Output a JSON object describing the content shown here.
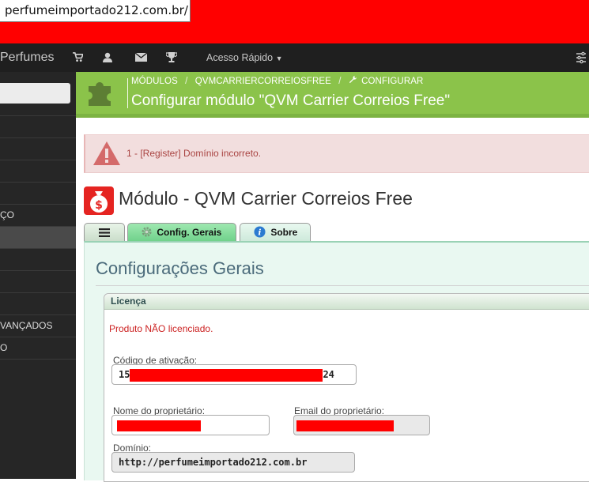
{
  "browser": {
    "url": "perfumeimportado212.com.br/"
  },
  "header": {
    "brand": "Perfumes",
    "icons": [
      "cart-icon",
      "user-icon",
      "envelope-icon",
      "trophy-icon"
    ],
    "quick_access": "Acesso Rápido",
    "right_icon": "settings-icon"
  },
  "sidebar": {
    "items": [
      {
        "label": ""
      },
      {
        "label": ""
      },
      {
        "label": ""
      },
      {
        "label": ""
      },
      {
        "label": "ÇO"
      },
      {
        "label": ""
      },
      {
        "label": ""
      },
      {
        "label": ""
      },
      {
        "label": ""
      },
      {
        "label": "VANÇADOS"
      },
      {
        "label": "O"
      }
    ],
    "active_index": 5
  },
  "module_header": {
    "breadcrumb": [
      "MÓDULOS",
      "QVMCARRIERCORREIOSFREE",
      "CONFIGURAR"
    ],
    "title": "Configurar módulo \"QVM Carrier Correios Free\""
  },
  "alert": {
    "text": "1 - [Register] Domínio incorreto."
  },
  "module": {
    "title": "Módulo - QVM Carrier Correios Free",
    "tabs": [
      "",
      "Config. Gerais",
      "Sobre"
    ]
  },
  "config": {
    "title": "Configurações Gerais",
    "legend": "Licença",
    "status": "Produto NÃO licenciado.",
    "activation_label": "Código de ativação:",
    "activation_prefix": "15",
    "activation_suffix": "24",
    "owner_label": "Nome do proprietário:",
    "email_label": "Email do proprietário:",
    "domain_label": "Domínio:",
    "domain_value": "http://perfumeimportado212.com.br"
  },
  "colors": {
    "accent_green": "#8bc34a",
    "alert_bg": "#f2dede",
    "alert_text": "#a94442",
    "redaction": "#ff0000"
  }
}
